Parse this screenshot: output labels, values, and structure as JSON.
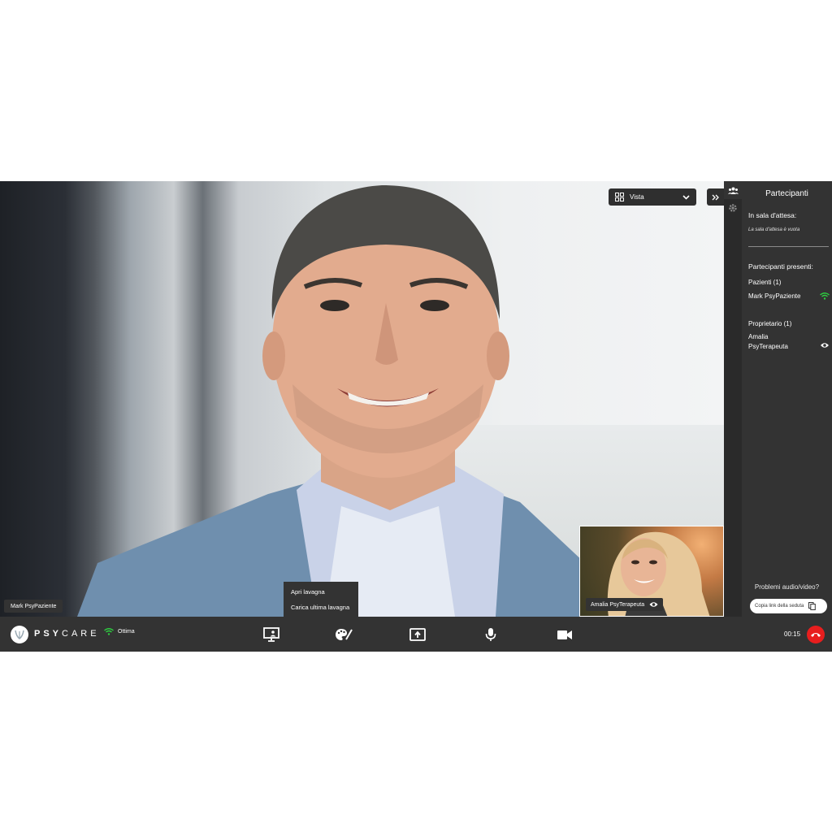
{
  "toolbar_top": {
    "view_label": "Vista"
  },
  "main_video": {
    "participant_name": "Mark PsyPaziente"
  },
  "self_video": {
    "participant_name": "Amalia PsyTerapeuta"
  },
  "whiteboard_menu": {
    "items": [
      "Apri lavagna",
      "Carica ultima lavagna"
    ]
  },
  "panel": {
    "title": "Partecipanti",
    "waiting_room_heading": "In sala d'attesa:",
    "waiting_room_note": "La sala d'attesa è vuota",
    "present_heading": "Partecipanti presenti:",
    "patients_heading": "Pazienti (1)",
    "patients": [
      "Mark PsyPaziente"
    ],
    "owner_heading": "Proprietario (1)",
    "owner_line1": "Amalia",
    "owner_line2": "PsyTerapeuta",
    "help_text": "Problemi audio/video?",
    "copy_link_label": "Copia link della seduta"
  },
  "bottom_bar": {
    "brand_bold": "PSY",
    "brand_light": "CARE",
    "connection_status": "Ottima",
    "timer": "00:15"
  },
  "colors": {
    "bar": "#333333",
    "signal": "#2ecc40",
    "hangup": "#e81e1e"
  }
}
